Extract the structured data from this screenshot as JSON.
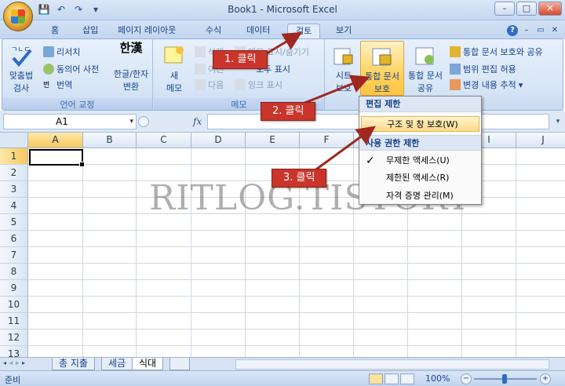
{
  "window": {
    "title": "Book1 - Microsoft Excel"
  },
  "qat": {
    "save": "💾",
    "undo": "↶",
    "redo": "↷",
    "customize": "▾"
  },
  "window_controls": {
    "minimize": "–",
    "maximize": "□",
    "close": "✕"
  },
  "tabs": [
    "홈",
    "삽입",
    "페이지 레이아웃",
    "수식",
    "데이터",
    "검토",
    "보기"
  ],
  "active_tab": "검토",
  "ribbon": {
    "proofing": {
      "label": "언어 교정",
      "spelling": [
        "맞춤법",
        "검사"
      ],
      "research": "리서치",
      "thesaurus": "동의어 사전",
      "translate": "번역",
      "hanja": [
        "한글/한자",
        "변환"
      ],
      "hanja_icon_text": "한漢"
    },
    "comments": {
      "label": "메모",
      "new_comment": [
        "새",
        "메모"
      ],
      "delete": "삭제",
      "previous": "이전",
      "next": "다음",
      "show_hide": "메모 표시/숨기기",
      "show_all": "모두 표시",
      "show_ink": "잉크 표시"
    },
    "changes": {
      "protect_sheet": [
        "시트",
        "보호"
      ],
      "protect_workbook": [
        "통합 문서",
        "보호"
      ],
      "share_workbook": [
        "통합 문서",
        "공유"
      ],
      "protect_and_share": "통합 문서 보호와 공유",
      "allow_edit_ranges": "범위 편집 허용",
      "track_changes": "변경 내용 추적"
    }
  },
  "formula_bar": {
    "name_box": "A1",
    "fx": "fx",
    "dropdown": "▾",
    "expand": "▾"
  },
  "columns": [
    "A",
    "B",
    "C",
    "D",
    "E",
    "F",
    "G",
    "H",
    "I",
    "J"
  ],
  "rows": [
    "1",
    "2",
    "3",
    "4",
    "5",
    "6",
    "7",
    "8",
    "9",
    "10",
    "11",
    "12",
    "13"
  ],
  "watermark": "RITLOG.TISTORY",
  "sheets": [
    "총 지출",
    "세금",
    "식대"
  ],
  "active_sheet": "식대",
  "sheet_nav": [
    "◂",
    "◃",
    "▹",
    "▸"
  ],
  "status": {
    "ready": "준비",
    "zoom": "100%",
    "zoom_minus": "−",
    "zoom_plus": "+"
  },
  "dropdown_menu": {
    "header_edit": "편집 제한",
    "protect_structure": "구조 및 창 보호(W)",
    "header_permission": "사용 권한 제한",
    "unrestricted": "무제한 액세스(U)",
    "restricted": "제한된 액세스(R)",
    "manage_credentials": "자격 증명 관리(M)",
    "check": "✓"
  },
  "annotations": {
    "step1": "1. 클릭",
    "step2": "2. 클릭",
    "step3": "3. 클릭"
  },
  "colors": {
    "accent": "#c9352b",
    "ribbon": "#d7e5f6",
    "highlight": "#ffd567"
  }
}
